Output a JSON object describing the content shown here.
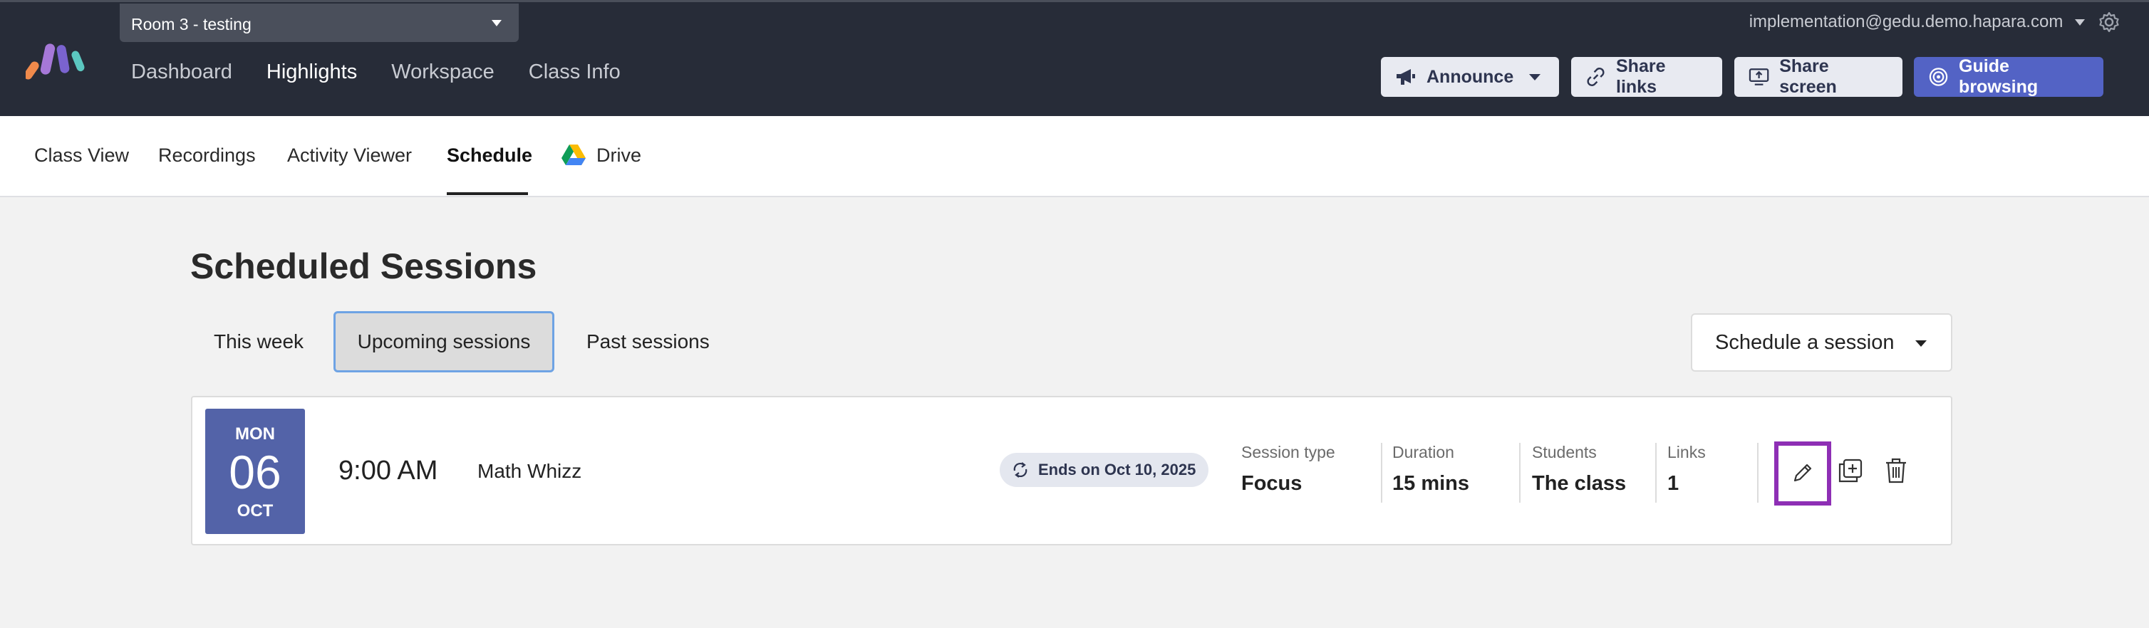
{
  "room": {
    "selected": "Room 3 - testing"
  },
  "main_nav": [
    {
      "label": "Dashboard",
      "active": false
    },
    {
      "label": "Highlights",
      "active": true
    },
    {
      "label": "Workspace",
      "active": false
    },
    {
      "label": "Class Info",
      "active": false
    }
  ],
  "account": {
    "email": "implementation@gedu.demo.hapara.com"
  },
  "toolbar": {
    "announce": "Announce",
    "share_links": "Share links",
    "share_screen": "Share screen",
    "guide_browsing": "Guide browsing"
  },
  "sub_nav": [
    {
      "label": "Class View",
      "active": false
    },
    {
      "label": "Recordings",
      "active": false
    },
    {
      "label": "Activity Viewer",
      "active": false
    },
    {
      "label": "Schedule",
      "active": true
    },
    {
      "label": "Drive",
      "active": false
    }
  ],
  "page": {
    "title": "Scheduled Sessions"
  },
  "filters": [
    {
      "label": "This week",
      "selected": false
    },
    {
      "label": "Upcoming sessions",
      "selected": true
    },
    {
      "label": "Past sessions",
      "selected": false
    }
  ],
  "schedule_button": "Schedule a session",
  "session": {
    "dow": "MON",
    "day": "06",
    "month": "OCT",
    "time": "9:00 AM",
    "name": "Math Whizz",
    "ends": "Ends on Oct 10, 2025",
    "meta": [
      {
        "label": "Session type",
        "value": "Focus"
      },
      {
        "label": "Duration",
        "value": "15 mins"
      },
      {
        "label": "Students",
        "value": "The class"
      },
      {
        "label": "Links",
        "value": "1"
      }
    ]
  },
  "colors": {
    "topbar": "#272c38",
    "accent": "#5363c5",
    "date_block": "#5363a8",
    "highlight_border": "#8e2fb5",
    "selected_filter_border": "#6ea3e4"
  }
}
